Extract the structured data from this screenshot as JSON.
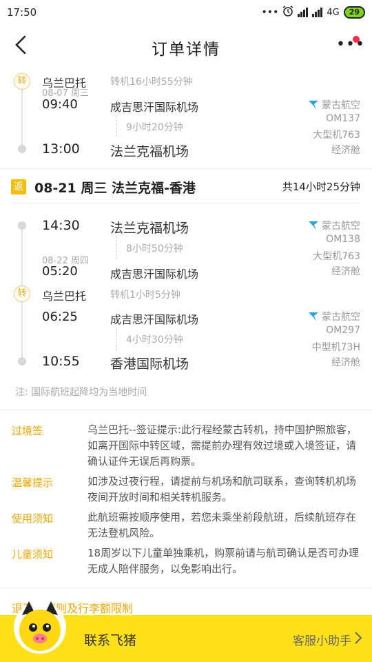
{
  "status_bar": {
    "time": "17:50",
    "dots": "•••",
    "network": "4G",
    "battery": "29"
  },
  "nav": {
    "title": "订单详情"
  },
  "outbound_tail": {
    "transfer": {
      "city": "乌兰巴托",
      "duration": "转机16小时55分钟",
      "badge": "转"
    },
    "leg": {
      "dep_date": "08-07 周三",
      "dep_time": "09:40",
      "dep_airport": "成吉思汗国际机场",
      "duration": "9小时20分钟",
      "arr_time": "13:00",
      "arr_airport": "法兰克福机场",
      "airline": "蒙古航空",
      "flight": "OM137",
      "aircraft": "大型机763",
      "cabin": "经济舱"
    }
  },
  "return": {
    "badge": "返",
    "title": "08-21 周三 法兰克福-香港",
    "total": "共14小时25分钟",
    "leg1": {
      "dep_time": "14:30",
      "dep_airport": "法兰克福机场",
      "duration": "8小时50分钟",
      "arr_date": "08-22 周四",
      "arr_time": "05:20",
      "arr_airport": "成吉思汗国际机场",
      "airline": "蒙古航空",
      "flight": "OM138",
      "aircraft": "大型机763",
      "cabin": "经济舱"
    },
    "transfer": {
      "city": "乌兰巴托",
      "duration": "转机1小时5分钟",
      "badge": "转"
    },
    "leg2": {
      "dep_time": "06:25",
      "dep_airport": "成吉思汗国际机场",
      "duration": "4小时30分钟",
      "arr_time": "10:55",
      "arr_airport": "香港国际机场",
      "airline": "蒙古航空",
      "flight": "OM297",
      "aircraft": "中型机73H",
      "cabin": "经济舱"
    }
  },
  "note": "注: 国际航班起降均为当地时间",
  "notes": [
    {
      "label": "过境签",
      "text": "乌兰巴托--签证提示:此行程经蒙古转机，持中国护照旅客，如离开国际中转区域，需提前办理有效过境或入境签证，请确认证件无误后再购票。"
    },
    {
      "label": "温馨提示",
      "text": "如涉及过夜行程，请提前与机场和航司联系，查询转机机场夜间开放时间和相关转机服务。"
    },
    {
      "label": "使用须知",
      "text": "此航班需按顺序使用，若您未乘坐前段航班，后续航班存在无法登机风险。"
    },
    {
      "label": "儿童须知",
      "text": "18周岁以下儿童单独乘机，购票前请与航司确认是否可办理无成人陪伴服务，以免影响出行。"
    }
  ],
  "rules_link": "退改签规则及行李额限制",
  "bottom": {
    "contact": "联系飞猪",
    "helper": "客服小助手"
  },
  "colors": {
    "accent": "#f0a700",
    "bottom_bar": "#ffe11a",
    "airline_icon": "#2a9fe0"
  }
}
